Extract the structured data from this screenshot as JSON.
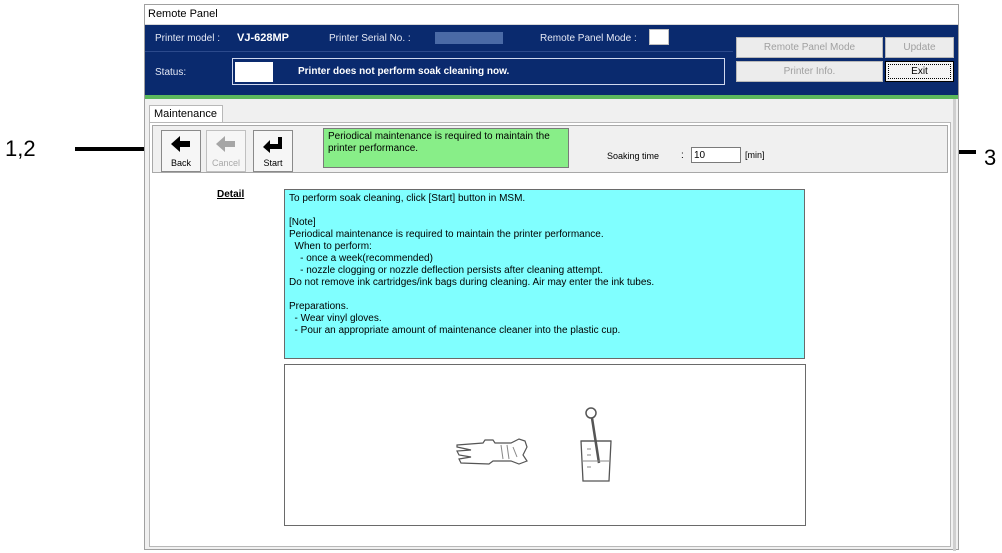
{
  "annotations": {
    "left_label": "1,2",
    "right_label": "3"
  },
  "window": {
    "title": "Remote Panel"
  },
  "header": {
    "printer_model_label": "Printer model :",
    "printer_model_value": "VJ-628MP",
    "serial_label": "Printer Serial No. :",
    "mode_label": "Remote Panel Mode :",
    "status_label": "Status:",
    "status_text": "Printer does not perform soak cleaning now."
  },
  "header_buttons": {
    "remote_panel_mode": "Remote Panel Mode",
    "update": "Update",
    "printer_info": "Printer Info.",
    "exit": "Exit"
  },
  "tabs": [
    {
      "label": "Maintenance"
    }
  ],
  "toolbar": {
    "back_label": "Back",
    "cancel_label": "Cancel",
    "start_label": "Start",
    "message": "Periodical maintenance is required to maintain the printer performance.",
    "soaking_time_label": "Soaking time",
    "soaking_time_colon": ":",
    "soaking_time_value": "10",
    "soaking_time_unit": "[min]"
  },
  "detail": {
    "label": "Detail",
    "lines": [
      "To perform soak cleaning, click [Start] button in MSM.",
      "",
      "[Note]",
      "Periodical maintenance is required to maintain the printer performance.",
      "  When to perform:",
      "    - once a week(recommended)",
      "    - nozzle clogging or nozzle deflection persists after cleaning attempt.",
      "Do not remove ink cartridges/ink bags during cleaning. Air may enter the ink tubes.",
      "",
      "Preparations.",
      "  - Wear vinyl gloves.",
      "  - Pour an appropriate amount of maintenance cleaner into the plastic cup."
    ]
  },
  "colors": {
    "header_bg": "#0a2a6e",
    "message_bg": "#88ee88",
    "detail_bg": "#80ffff",
    "green_bar": "#5cb85c"
  },
  "icons": {
    "back": "arrow-left-icon",
    "cancel": "arrow-left-icon",
    "start": "return-arrow-icon",
    "glove": "glove-icon",
    "cup": "cup-with-stick-icon"
  }
}
